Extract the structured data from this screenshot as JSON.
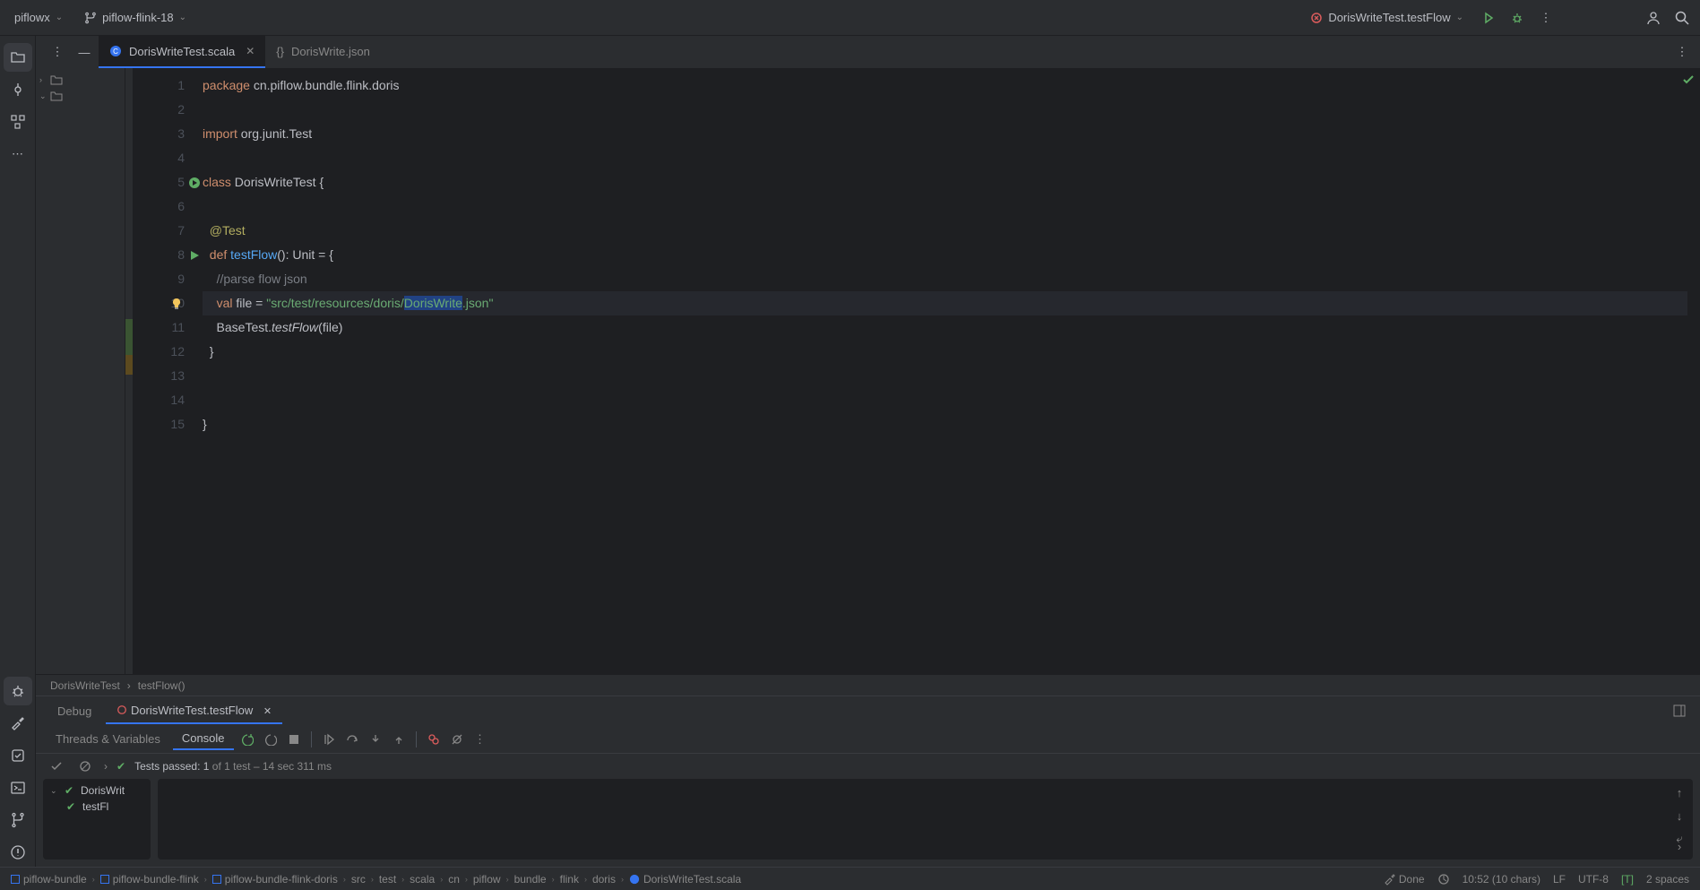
{
  "topbar": {
    "project": "piflowx",
    "branch": "piflow-flink-18",
    "runConfig": "DorisWriteTest.testFlow"
  },
  "tabs": [
    {
      "name": "DorisWriteTest.scala",
      "active": true,
      "icon": "scala"
    },
    {
      "name": "DorisWrite.json",
      "active": false,
      "icon": "json"
    }
  ],
  "editor": {
    "lines": [
      {
        "n": 1,
        "raw": "package cn.piflow.bundle.flink.doris"
      },
      {
        "n": 2,
        "raw": ""
      },
      {
        "n": 3,
        "raw": "import org.junit.Test"
      },
      {
        "n": 4,
        "raw": ""
      },
      {
        "n": 5,
        "raw": "class DorisWriteTest {",
        "icon": "run-class"
      },
      {
        "n": 6,
        "raw": ""
      },
      {
        "n": 7,
        "raw": "  @Test"
      },
      {
        "n": 8,
        "raw": "  def testFlow(): Unit = {",
        "icon": "run-test"
      },
      {
        "n": 9,
        "raw": "    //parse flow json"
      },
      {
        "n": 10,
        "raw": "    val file = \"src/test/resources/doris/DorisWrite.json\"",
        "current": true,
        "bulb": true
      },
      {
        "n": 11,
        "raw": "    BaseTest.testFlow(file)"
      },
      {
        "n": 12,
        "raw": "  }"
      },
      {
        "n": 13,
        "raw": ""
      },
      {
        "n": 14,
        "raw": ""
      },
      {
        "n": 15,
        "raw": "}"
      }
    ],
    "breadcrumb": [
      "DorisWriteTest",
      "testFlow()"
    ]
  },
  "debug": {
    "label": "Debug",
    "tab": "DorisWriteTest.testFlow",
    "sections": [
      "Threads & Variables",
      "Console"
    ],
    "testsPassedPrefix": "Tests passed: 1",
    "testsPassedSuffix": " of 1 test – 14 sec 311 ms",
    "tree": [
      {
        "label": "DorisWrit",
        "indent": 0,
        "expanded": true
      },
      {
        "label": "testFl",
        "indent": 1
      }
    ]
  },
  "statusbar": {
    "path": [
      "piflow-bundle",
      "piflow-bundle-flink",
      "piflow-bundle-flink-doris",
      "src",
      "test",
      "scala",
      "cn",
      "piflow",
      "bundle",
      "flink",
      "doris"
    ],
    "file": "DorisWriteTest.scala",
    "done": "Done",
    "cursor": "10:52 (10 chars)",
    "lineSep": "LF",
    "encoding": "UTF-8",
    "tab": "[T]",
    "indent": "2 spaces"
  }
}
